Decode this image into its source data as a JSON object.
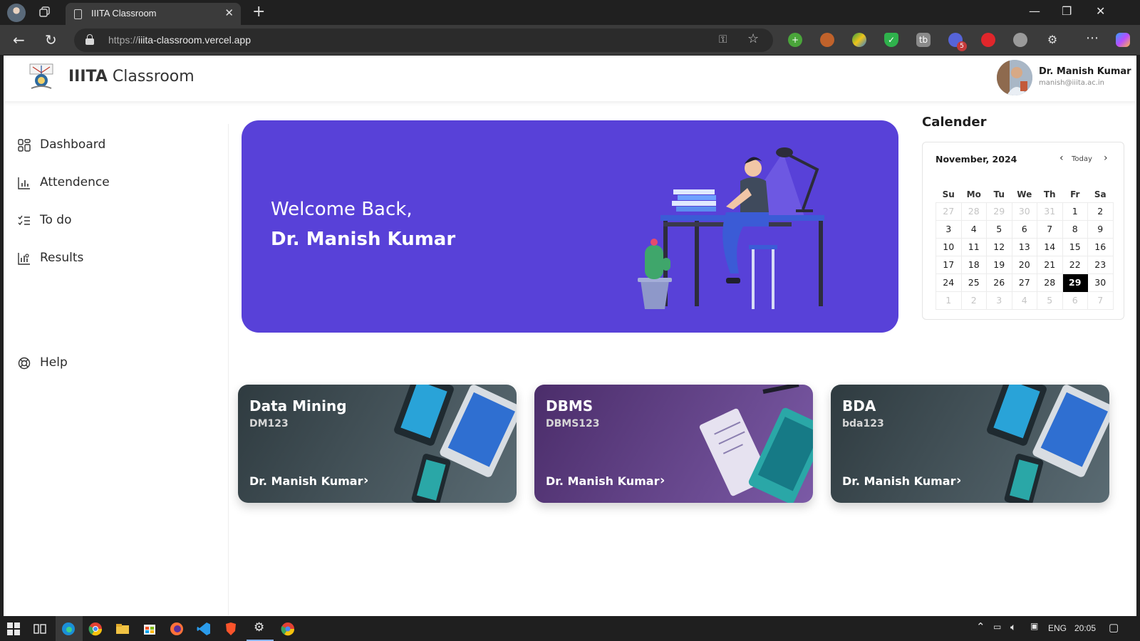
{
  "browser": {
    "tab_title": "IIITA Classroom",
    "url_protocol": "https://",
    "url_host": "iiita-classroom.vercel.app",
    "ext_badge": "5"
  },
  "header": {
    "brand_bold": "IIITA",
    "brand_rest": " Classroom",
    "user_name": "Dr. Manish Kumar",
    "user_email": "manish@iiita.ac.in"
  },
  "sidebar": {
    "items": [
      {
        "label": "Dashboard",
        "icon": "dashboard-icon"
      },
      {
        "label": "Attendence",
        "icon": "bar-chart-icon"
      },
      {
        "label": "To do",
        "icon": "checklist-icon"
      },
      {
        "label": "Results",
        "icon": "results-chart-icon"
      }
    ],
    "help": {
      "label": "Help",
      "icon": "lifebuoy-icon"
    }
  },
  "hero": {
    "greeting": "Welcome Back,",
    "name": "Dr. Manish Kumar",
    "color": "#5841d8"
  },
  "calendar": {
    "title": "Calender",
    "month": "November, 2024",
    "today_label": "Today",
    "weekdays": [
      "Su",
      "Mo",
      "Tu",
      "We",
      "Th",
      "Fr",
      "Sa"
    ],
    "weeks": [
      [
        {
          "d": "27",
          "m": true
        },
        {
          "d": "28",
          "m": true
        },
        {
          "d": "29",
          "m": true
        },
        {
          "d": "30",
          "m": true
        },
        {
          "d": "31",
          "m": true
        },
        {
          "d": "1"
        },
        {
          "d": "2"
        }
      ],
      [
        {
          "d": "3"
        },
        {
          "d": "4"
        },
        {
          "d": "5"
        },
        {
          "d": "6"
        },
        {
          "d": "7"
        },
        {
          "d": "8"
        },
        {
          "d": "9"
        }
      ],
      [
        {
          "d": "10"
        },
        {
          "d": "11"
        },
        {
          "d": "12"
        },
        {
          "d": "13"
        },
        {
          "d": "14"
        },
        {
          "d": "15"
        },
        {
          "d": "16"
        }
      ],
      [
        {
          "d": "17"
        },
        {
          "d": "18"
        },
        {
          "d": "19"
        },
        {
          "d": "20"
        },
        {
          "d": "21"
        },
        {
          "d": "22"
        },
        {
          "d": "23"
        }
      ],
      [
        {
          "d": "24"
        },
        {
          "d": "25"
        },
        {
          "d": "26"
        },
        {
          "d": "27"
        },
        {
          "d": "28"
        },
        {
          "d": "29",
          "sel": true
        },
        {
          "d": "30"
        }
      ],
      [
        {
          "d": "1",
          "m": true
        },
        {
          "d": "2",
          "m": true
        },
        {
          "d": "3",
          "m": true
        },
        {
          "d": "4",
          "m": true
        },
        {
          "d": "5",
          "m": true
        },
        {
          "d": "6",
          "m": true
        },
        {
          "d": "7",
          "m": true
        }
      ]
    ]
  },
  "courses": [
    {
      "name": "Data Mining",
      "code": "DM123",
      "teacher": "Dr. Manish Kumar",
      "bg_from": "#2f3b40",
      "bg_to": "#5a6b73"
    },
    {
      "name": "DBMS",
      "code": "DBMS123",
      "teacher": "Dr. Manish Kumar",
      "bg_from": "#4b2d6a",
      "bg_to": "#7b5aa6"
    },
    {
      "name": "BDA",
      "code": "bda123",
      "teacher": "Dr. Manish Kumar",
      "bg_from": "#2f3b40",
      "bg_to": "#5a6b73"
    }
  ],
  "taskbar": {
    "lang": "ENG",
    "time": "20:05"
  }
}
